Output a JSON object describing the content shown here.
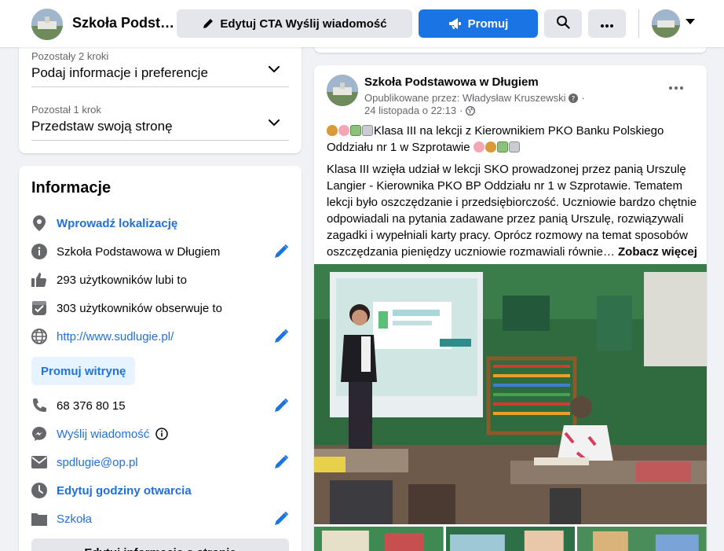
{
  "header": {
    "page_name": "Szkoła Podst…",
    "edit_cta_label": "Edytuj CTA Wyślij wiadomość",
    "promote_label": "Promuj"
  },
  "steps": [
    {
      "remaining": "Pozostały 2 kroki",
      "title": "Podaj informacje i preferencje"
    },
    {
      "remaining": "Pozostał 1 krok",
      "title": "Przedstaw swoją stronę"
    }
  ],
  "info": {
    "title": "Informacje",
    "location": "Wprowadź lokalizację",
    "page_name": "Szkoła Podstawowa w Długiem",
    "likes": "293 użytkowników lubi to",
    "followers": "303 użytkowników obserwuje to",
    "website": "http://www.sudlugie.pl/",
    "promote_site": "Promuj witrynę",
    "phone": "68 376 80 15",
    "message": "Wyślij wiadomość",
    "email": "spdlugie@op.pl",
    "hours": "Edytuj godziny otwarcia",
    "category": "Szkoła",
    "edit_info_button": "Edytuj informacje o stronie"
  },
  "post": {
    "author": "Szkoła Podstawowa w Długiem",
    "published_by": "Opublikowane przez: Władysław Kruszewski",
    "date": "24 listopada o 22:13",
    "headline_1": "Klasa III na lekcji z Kierownikiem PKO Banku Polskiego",
    "headline_2": "Oddziału nr 1 w Szprotawie",
    "body": "Klasa III wzięła udział w lekcji SKO prowadzonej przez panią Urszulę Langier - Kierownika PKO BP Oddziału nr 1 w Szprotawie.  Tematem lekcji było oszczędzanie i przedsiębiorczość. Uczniowie bardzo chętnie odpowiadali na pytania zadawane przez panią Urszulę, rozwiązywali zagadki i wypełniali karty pracy. Oprócz rozmowy na temat sposobów oszczędzania pieniędzy uczniowie rozmawiali równie…",
    "see_more": "Zobacz więcej"
  },
  "icons": {
    "edit": "pencil-icon",
    "promote": "megaphone-icon",
    "search": "search-icon",
    "more": "more-dots-icon"
  },
  "colors": {
    "accent": "#1b74e4",
    "link": "#216fdb",
    "background": "#f0f2f5",
    "secondary_text": "#65676b"
  }
}
